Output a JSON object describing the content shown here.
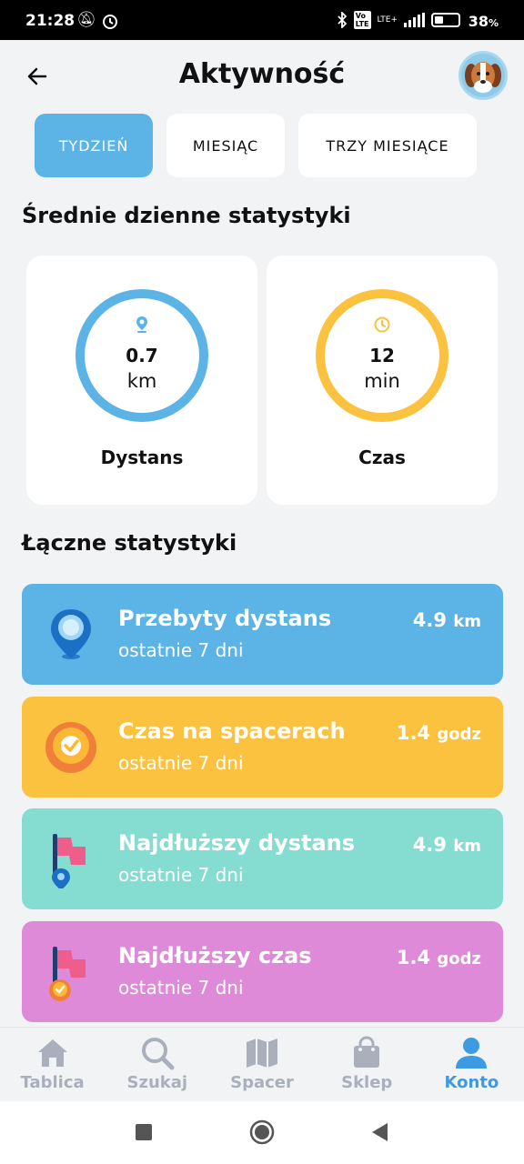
{
  "status_bar": {
    "time": "21:28",
    "battery_pct": "38",
    "battery_suffix": "%",
    "network": "LTE+",
    "icons": [
      "mute-icon",
      "alarm-icon",
      "bluetooth-icon",
      "volte-icon",
      "signal-icon",
      "battery-icon"
    ]
  },
  "header": {
    "title": "Aktywność",
    "back_icon": "arrow-left-icon",
    "avatar": "dog-avatar"
  },
  "tabs": [
    {
      "label": "TYDZIEŃ",
      "active": true
    },
    {
      "label": "MIESIĄC",
      "active": false
    },
    {
      "label": "TRZY MIESIĄCE",
      "active": false
    }
  ],
  "daily": {
    "title": "Średnie dzienne statystyki",
    "cards": [
      {
        "value": "0.7",
        "unit": "km",
        "label": "Dystans",
        "icon": "location-pin-icon",
        "color": "#5bb3e6"
      },
      {
        "value": "12",
        "unit": "min",
        "label": "Czas",
        "icon": "clock-icon",
        "color": "#fbc23f"
      }
    ]
  },
  "totals": {
    "title": "Łączne statystyki",
    "rows": [
      {
        "title": "Przebyty dystans",
        "subtitle": "ostatnie 7 dni",
        "value": "4.9",
        "unit": "km",
        "color": "#5bb3e6",
        "icon": "map-pin-icon"
      },
      {
        "title": "Czas na spacerach",
        "subtitle": "ostatnie 7 dni",
        "value": "1.4",
        "unit": "godz",
        "color": "#fbc23f",
        "icon": "clock-badge-icon"
      },
      {
        "title": "Najdłuższy dystans",
        "subtitle": "ostatnie 7 dni",
        "value": "4.9",
        "unit": "km",
        "color": "#85dcd0",
        "icon": "flag-pin-icon"
      },
      {
        "title": "Najdłuższy czas",
        "subtitle": "ostatnie 7 dni",
        "value": "1.4",
        "unit": "godz",
        "color": "#de8ad8",
        "icon": "flag-clock-icon"
      }
    ]
  },
  "nav": [
    {
      "label": "Tablica",
      "icon": "home-icon",
      "active": false
    },
    {
      "label": "Szukaj",
      "icon": "search-icon",
      "active": false
    },
    {
      "label": "Spacer",
      "icon": "map-icon",
      "active": false
    },
    {
      "label": "Sklep",
      "icon": "shopping-bag-icon",
      "active": false
    },
    {
      "label": "Konto",
      "icon": "user-icon",
      "active": true
    }
  ],
  "system_nav": [
    "recents-button",
    "home-button",
    "back-button"
  ]
}
